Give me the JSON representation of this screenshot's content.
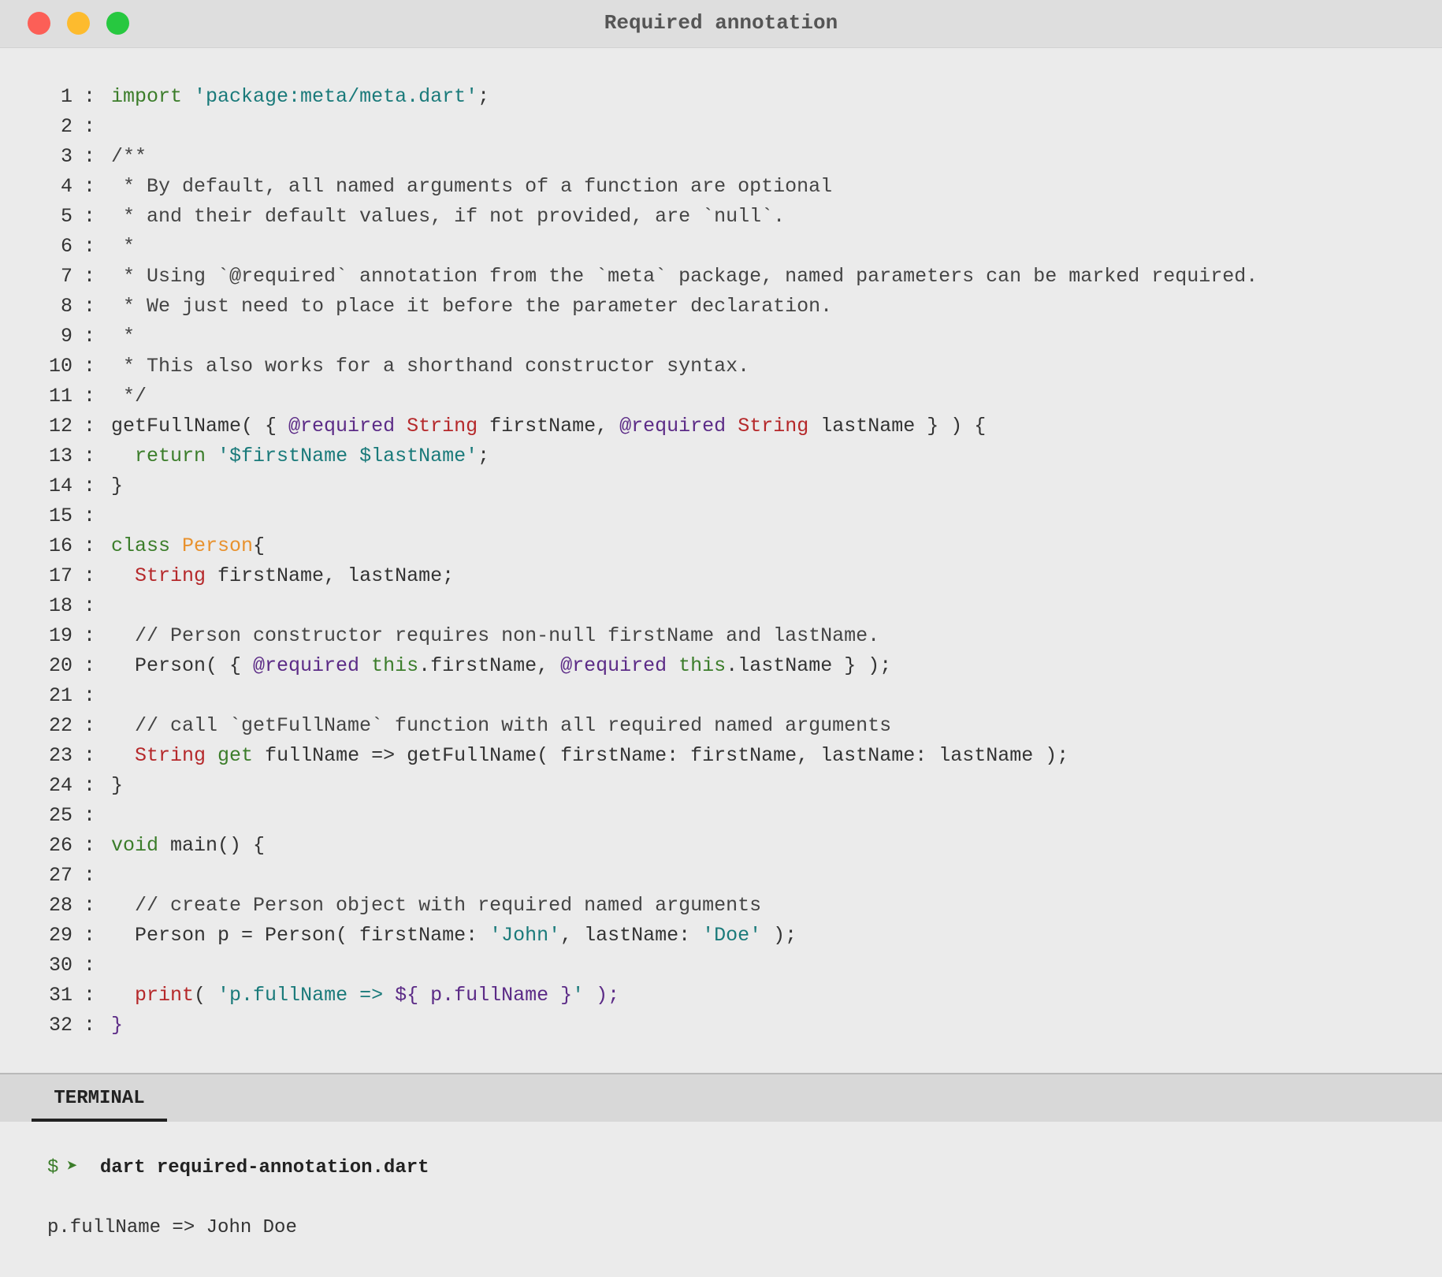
{
  "window": {
    "title": "Required annotation"
  },
  "editor": {
    "separator": ":",
    "lines": [
      {
        "n": "1",
        "tokens": [
          {
            "t": "import ",
            "c": "kw"
          },
          {
            "t": "'package:meta/meta.dart'",
            "c": "str"
          },
          {
            "t": ";",
            "c": ""
          }
        ]
      },
      {
        "n": "2",
        "tokens": []
      },
      {
        "n": "3",
        "tokens": [
          {
            "t": "/**",
            "c": "cmt"
          }
        ]
      },
      {
        "n": "4",
        "tokens": [
          {
            "t": " * By default, all named arguments of a function are optional",
            "c": "cmt"
          }
        ]
      },
      {
        "n": "5",
        "tokens": [
          {
            "t": " * and their default values, if not provided, are `null`.",
            "c": "cmt"
          }
        ]
      },
      {
        "n": "6",
        "tokens": [
          {
            "t": " *",
            "c": "cmt"
          }
        ]
      },
      {
        "n": "7",
        "tokens": [
          {
            "t": " * Using `@required` annotation from the `meta` package, named parameters can be marked required.",
            "c": "cmt"
          }
        ]
      },
      {
        "n": "8",
        "tokens": [
          {
            "t": " * We just need to place it before the parameter declaration.",
            "c": "cmt"
          }
        ]
      },
      {
        "n": "9",
        "tokens": [
          {
            "t": " *",
            "c": "cmt"
          }
        ]
      },
      {
        "n": "10",
        "tokens": [
          {
            "t": " * This also works for a shorthand constructor syntax.",
            "c": "cmt"
          }
        ]
      },
      {
        "n": "11",
        "tokens": [
          {
            "t": " */",
            "c": "cmt"
          }
        ]
      },
      {
        "n": "12",
        "tokens": [
          {
            "t": "getFullName( { ",
            "c": ""
          },
          {
            "t": "@required",
            "c": "ann"
          },
          {
            "t": " ",
            "c": ""
          },
          {
            "t": "String",
            "c": "type"
          },
          {
            "t": " firstName, ",
            "c": ""
          },
          {
            "t": "@required",
            "c": "ann"
          },
          {
            "t": " ",
            "c": ""
          },
          {
            "t": "String",
            "c": "type"
          },
          {
            "t": " lastName } ) {",
            "c": ""
          }
        ]
      },
      {
        "n": "13",
        "tokens": [
          {
            "t": "  ",
            "c": ""
          },
          {
            "t": "return ",
            "c": "kw"
          },
          {
            "t": "'$firstName $lastName'",
            "c": "str"
          },
          {
            "t": ";",
            "c": ""
          }
        ]
      },
      {
        "n": "14",
        "tokens": [
          {
            "t": "}",
            "c": ""
          }
        ]
      },
      {
        "n": "15",
        "tokens": []
      },
      {
        "n": "16",
        "tokens": [
          {
            "t": "class ",
            "c": "kw"
          },
          {
            "t": "Person",
            "c": "cls"
          },
          {
            "t": "{",
            "c": ""
          }
        ]
      },
      {
        "n": "17",
        "tokens": [
          {
            "t": "  ",
            "c": ""
          },
          {
            "t": "String",
            "c": "type"
          },
          {
            "t": " firstName, lastName;",
            "c": ""
          }
        ]
      },
      {
        "n": "18",
        "tokens": []
      },
      {
        "n": "19",
        "tokens": [
          {
            "t": "  // Person constructor requires non-null firstName and lastName.",
            "c": "cmt"
          }
        ]
      },
      {
        "n": "20",
        "tokens": [
          {
            "t": "  Person( { ",
            "c": ""
          },
          {
            "t": "@required",
            "c": "ann"
          },
          {
            "t": " ",
            "c": ""
          },
          {
            "t": "this",
            "c": "kw"
          },
          {
            "t": ".firstName, ",
            "c": ""
          },
          {
            "t": "@required",
            "c": "ann"
          },
          {
            "t": " ",
            "c": ""
          },
          {
            "t": "this",
            "c": "kw"
          },
          {
            "t": ".lastName } );",
            "c": ""
          }
        ]
      },
      {
        "n": "21",
        "tokens": []
      },
      {
        "n": "22",
        "tokens": [
          {
            "t": "  // call `getFullName` function with all required named arguments",
            "c": "cmt"
          }
        ]
      },
      {
        "n": "23",
        "tokens": [
          {
            "t": "  ",
            "c": ""
          },
          {
            "t": "String",
            "c": "type"
          },
          {
            "t": " ",
            "c": ""
          },
          {
            "t": "get",
            "c": "kw"
          },
          {
            "t": " fullName => getFullName( firstName: firstName, lastName: lastName );",
            "c": ""
          }
        ]
      },
      {
        "n": "24",
        "tokens": [
          {
            "t": "}",
            "c": ""
          }
        ]
      },
      {
        "n": "25",
        "tokens": []
      },
      {
        "n": "26",
        "tokens": [
          {
            "t": "void",
            "c": "kw"
          },
          {
            "t": " main() {",
            "c": ""
          }
        ]
      },
      {
        "n": "27",
        "tokens": []
      },
      {
        "n": "28",
        "tokens": [
          {
            "t": "  // create Person object with required named arguments",
            "c": "cmt"
          }
        ]
      },
      {
        "n": "29",
        "tokens": [
          {
            "t": "  Person p = Person( firstName: ",
            "c": ""
          },
          {
            "t": "'John'",
            "c": "str"
          },
          {
            "t": ", lastName: ",
            "c": ""
          },
          {
            "t": "'Doe'",
            "c": "str"
          },
          {
            "t": " );",
            "c": ""
          }
        ]
      },
      {
        "n": "30",
        "tokens": []
      },
      {
        "n": "31",
        "tokens": [
          {
            "t": "  ",
            "c": ""
          },
          {
            "t": "print",
            "c": "fn"
          },
          {
            "t": "( ",
            "c": ""
          },
          {
            "t": "'p.fullName => ",
            "c": "str"
          },
          {
            "t": "${ p.fullName }",
            "c": "ann"
          },
          {
            "t": "'",
            "c": "str"
          },
          {
            "t": " );",
            "c": "ann"
          }
        ]
      },
      {
        "n": "32",
        "tokens": [
          {
            "t": "}",
            "c": "brace"
          }
        ]
      }
    ]
  },
  "terminal": {
    "tab_label": "TERMINAL",
    "prompt_symbol": "$",
    "prompt_arrow": "➤",
    "command": "dart required-annotation.dart",
    "output": "p.fullName => John Doe"
  }
}
